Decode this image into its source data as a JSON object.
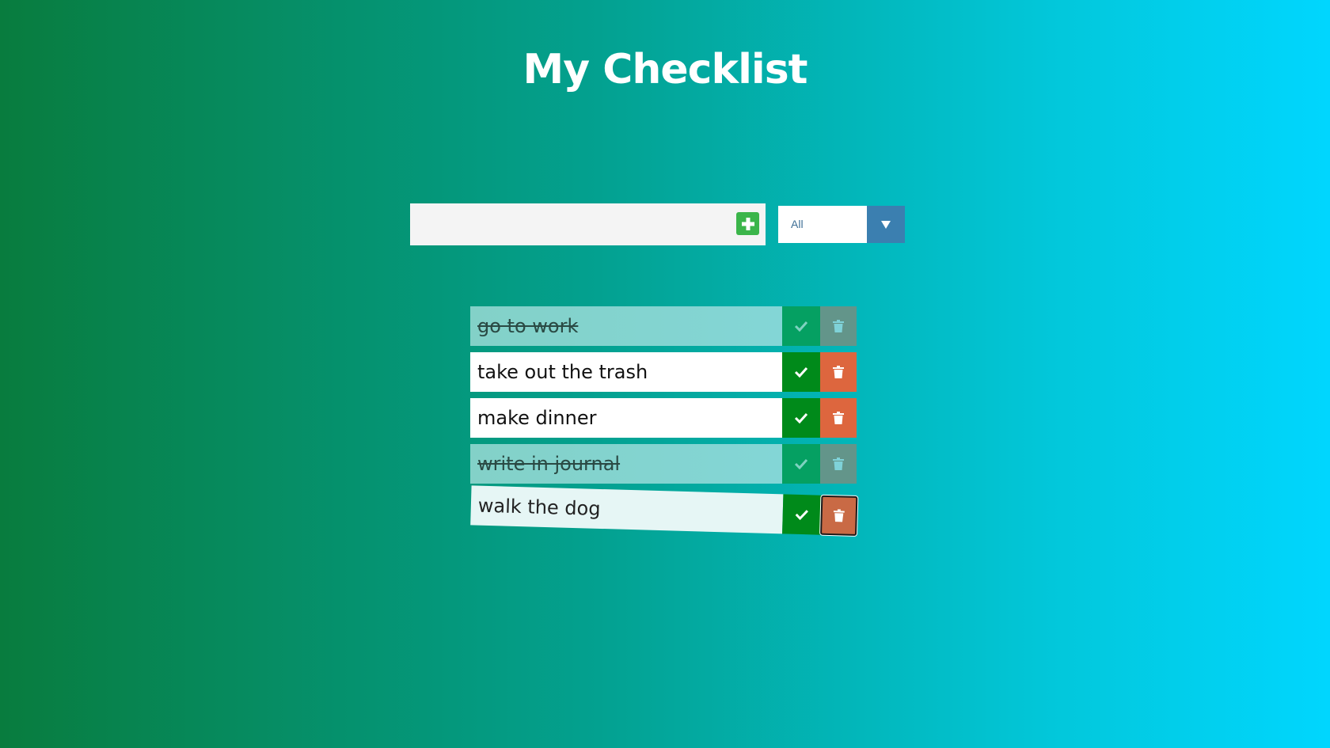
{
  "header": {
    "title": "My Checklist"
  },
  "form": {
    "input_value": "",
    "input_placeholder": "",
    "add_icon": "plus-icon"
  },
  "filter": {
    "selected": "All",
    "arrow_icon": "caret-down-icon"
  },
  "todos": [
    {
      "text": "go to work",
      "completed": true
    },
    {
      "text": "take out the trash",
      "completed": false
    },
    {
      "text": "make dinner",
      "completed": false
    },
    {
      "text": "write in journal",
      "completed": true
    },
    {
      "text": "walk the dog",
      "completed": false
    }
  ],
  "colors": {
    "background_start": "#087c3e",
    "background_end": "#00d6fe",
    "check_button": "#008a1a",
    "trash_button": "#dd663e",
    "add_button": "#3bb54a",
    "filter_arrow": "#3b7fb0"
  }
}
